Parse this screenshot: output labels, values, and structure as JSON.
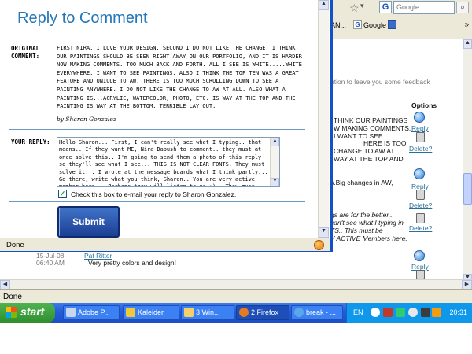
{
  "browser": {
    "search_placeholder": "Google",
    "bookmarks": [
      "AN...",
      "Google"
    ],
    "status": "Done"
  },
  "background_page": {
    "hint_text": "otion to leave you some feedback",
    "options_label": "Options",
    "comment_lines": [
      "THINK OUR PAINTINGS",
      "W MAKING COMMENTS.",
      "I WANT TO SEE",
      "HERE IS TOO",
      "CHANGE TO AW AT",
      "WAY AT THE TOP AND"
    ],
    "line_aw": "s.Big changes in AW,",
    "line_better": "gs are for the better...",
    "line_typing": "can't see what I typing in",
    "line_this": "TS.. This must be",
    "line_active": "Y ACTIVE Members here.",
    "reply_link": "Reply",
    "delete_link": "Delete?",
    "comment_date": "15-Jul-08",
    "comment_time": "06:40 AM",
    "comment_author": "Pat Ritter",
    "comment_text": "Very pretty colors and design!"
  },
  "popup": {
    "title": "Reply to Comment",
    "original_label": "ORIGINAL COMMENT:",
    "original_text": "FIRST NIRA, I LOVE YOUR DESIGN. SECOND I DO NOT LIKE THE CHANGE. I THINK OUR PAINTINGS SHOULD BE SEEN RIGHT AWAY ON OUR PORTFOLIO, AND IT IS HARDER NOW MAKING COMMENTS. TOO MUCH BACK AND FORTH. ALL I SEE IS WHITE.....WHITE EVERYWHERE. I WANT TO SEE PAINTINGS. ALSO I THINK THE TOP TEN WAS A GREAT FEATURE AND UNIQUE TO AW. THERE IS TOO MUCH SCROLLING DOWN TO SEE A PAINTING ANYWHERE. I DO NOT LIKE THE CHANGE TO AW AT ALL. ALSO WHAT A PAINTING IS...ACRYLIC, WATERCOLOR, PHOTO, ETC. IS WAY AT THE TOP AND THE PAINTING IS WAY AT THE BOTTOM. TERRIBLE LAY OUT.",
    "original_author": "by Sharon Gonzalez",
    "reply_label": "YOUR REPLY:",
    "reply_text": "Hello Sharon... First, I can't really see what I typing.. that means.. If they want ME, Nira Dabush to comment.. they must at once solve this.. I'm going to send them a photo of this reply so they'll see what I see... THIS IS NOT CLEAR FONTS. They must solve it... I wrote at the message boards what I think partly... Go there, write what you think, Sharon.. You are very active member here... Perhaps they will listen to us :) . They must, because a lot of",
    "email_checkbox_label": "Check this box to e-mail your reply to Sharon Gonzalez.",
    "submit_label": "Submit",
    "status": "Done"
  },
  "taskbar": {
    "start_label": "start",
    "tasks": [
      "Adobe P...",
      "Kaleider",
      "3 Win...",
      "2 Firefox",
      "break - ..."
    ],
    "language": "EN",
    "clock": "20:31"
  }
}
